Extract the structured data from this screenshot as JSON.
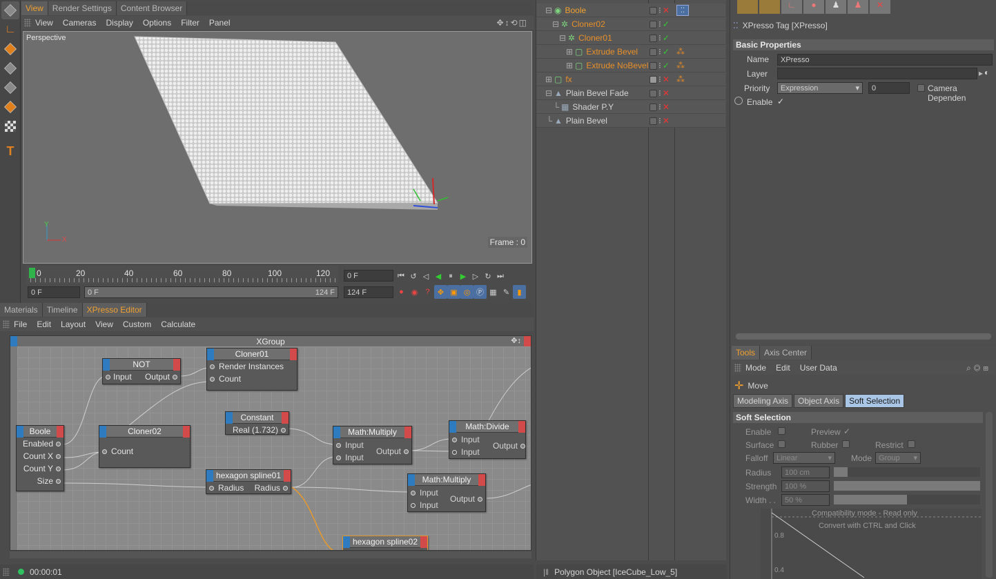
{
  "viewport": {
    "tabs": [
      "View",
      "Render Settings",
      "Content Browser"
    ],
    "menu": [
      "View",
      "Cameras",
      "Display",
      "Options",
      "Filter",
      "Panel"
    ],
    "camera_label": "Perspective",
    "frame_text": "Frame : 0",
    "axis_y": "Y",
    "axis_x": "X"
  },
  "timeline": {
    "ticks": [
      "0",
      "20",
      "40",
      "60",
      "80",
      "100",
      "120"
    ],
    "current_frame": "0 F",
    "start_frame": "0 F",
    "range_start": "0 F",
    "range_end": "124 F",
    "end_frame": "124 F"
  },
  "editor": {
    "tabs": [
      "Materials",
      "Timeline",
      "XPresso Editor"
    ],
    "menu": [
      "File",
      "Edit",
      "Layout",
      "View",
      "Custom",
      "Calculate"
    ],
    "group_title": "XGroup",
    "status_time": "00:00:01"
  },
  "nodes": {
    "not": {
      "title": "NOT",
      "in": "Input",
      "out": "Output"
    },
    "cloner01": {
      "title": "Cloner01",
      "p1": "Render Instances",
      "p2": "Count"
    },
    "constant": {
      "title": "Constant",
      "p1": "Real (1.732)"
    },
    "boole": {
      "title": "Boole",
      "p1": "Enabled",
      "p2": "Count X",
      "p3": "Count Y",
      "p4": "Size"
    },
    "cloner02": {
      "title": "Cloner02",
      "p1": "Count"
    },
    "mult1": {
      "title": "Math:Multiply",
      "in1": "Input",
      "in2": "Input",
      "out": "Output"
    },
    "divide": {
      "title": "Math:Divide",
      "in1": "Input",
      "in2": "Input",
      "out": "Output"
    },
    "hex1": {
      "title": "hexagon spline01",
      "in": "Radius",
      "out": "Radius"
    },
    "mult2": {
      "title": "Math:Multiply",
      "in1": "Input",
      "in2": "Input",
      "out": "Output"
    },
    "hex2": {
      "title": "hexagon spline02"
    }
  },
  "hierarchy": {
    "items": [
      {
        "name": "Boole"
      },
      {
        "name": "Cloner02"
      },
      {
        "name": "Cloner01"
      },
      {
        "name": "Extrude Bevel"
      },
      {
        "name": "Extrude NoBevel"
      },
      {
        "name": "fx"
      },
      {
        "name": "Plain Bevel Fade"
      },
      {
        "name": "Shader P.Y"
      },
      {
        "name": "Plain Bevel"
      }
    ],
    "status": "Polygon Object [IceCube_Low_5]"
  },
  "attributes": {
    "title": "XPresso Tag [XPresso]",
    "section": "Basic Properties",
    "name_label": "Name",
    "name_value": "XPresso",
    "layer_label": "Layer",
    "priority_label": "Priority",
    "priority_value": "Expression",
    "priority_num": "0",
    "camera_label": "Camera Dependen",
    "enable_label": "Enable"
  },
  "tools": {
    "tabs": [
      "Tools",
      "Axis Center"
    ],
    "menu": [
      "Mode",
      "Edit",
      "User Data"
    ],
    "move_label": "Move",
    "subtabs": [
      "Modeling Axis",
      "Object Axis",
      "Soft Selection"
    ],
    "section": "Soft Selection",
    "enable": "Enable",
    "preview": "Preview",
    "surface": "Surface",
    "rubber": "Rubber",
    "restrict": "Restrict",
    "falloff_label": "Falloff",
    "falloff_value": "Linear",
    "mode_label": "Mode",
    "mode_value": "Group",
    "radius_label": "Radius",
    "radius_value": "100 cm",
    "strength_label": "Strength",
    "strength_value": "100 %",
    "width_label": "Width . .",
    "width_value": "50 %",
    "graph_text1": "Compatibility mode - Read only",
    "graph_text2": "Convert with CTRL and Click",
    "graph_y1": "0.8",
    "graph_y2": "0.4"
  }
}
